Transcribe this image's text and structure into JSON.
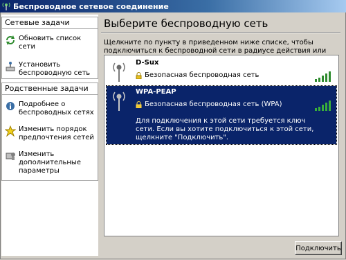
{
  "window": {
    "title": "Беспроводное сетевое соединение"
  },
  "sidebar": {
    "network_tasks": {
      "title": "Сетевые задачи",
      "items": [
        {
          "label": "Обновить список сети",
          "icon": "refresh-icon"
        },
        {
          "label": "Установить беспроводную сеть",
          "icon": "setup-network-icon"
        }
      ]
    },
    "related_tasks": {
      "title": "Родственные задачи",
      "items": [
        {
          "label": "Подробнее о беспроводных сетях",
          "icon": "info-icon"
        },
        {
          "label": "Изменить порядок предпочтения  сетей",
          "icon": "star-icon"
        },
        {
          "label": "Изменить дополнительные параметры",
          "icon": "settings-icon"
        }
      ]
    }
  },
  "main": {
    "heading": "Выберите беспроводную сеть",
    "instructions": "Щелкните по пункту в приведенном ниже списке, чтобы подключиться к беспроводной сети в радиусе действия или получить дополнительные сведения.",
    "networks": [
      {
        "ssid": "D-Sux",
        "security": "Безопасная беспроводная сеть",
        "signal_bars": 5,
        "selected": false
      },
      {
        "ssid": "WPA-PEAP",
        "security": "Безопасная беспроводная сеть (WPA)",
        "signal_bars": 5,
        "selected": true,
        "description": "Для подключения к этой сети требуется ключ сети. Если вы хотите подключиться к этой сети, щелкните \"Подключить\"."
      }
    ],
    "connect_button": "Подключить"
  },
  "colors": {
    "selection": "#0a246a",
    "signal": "#2e8b2e",
    "background": "#d4d0c8"
  }
}
